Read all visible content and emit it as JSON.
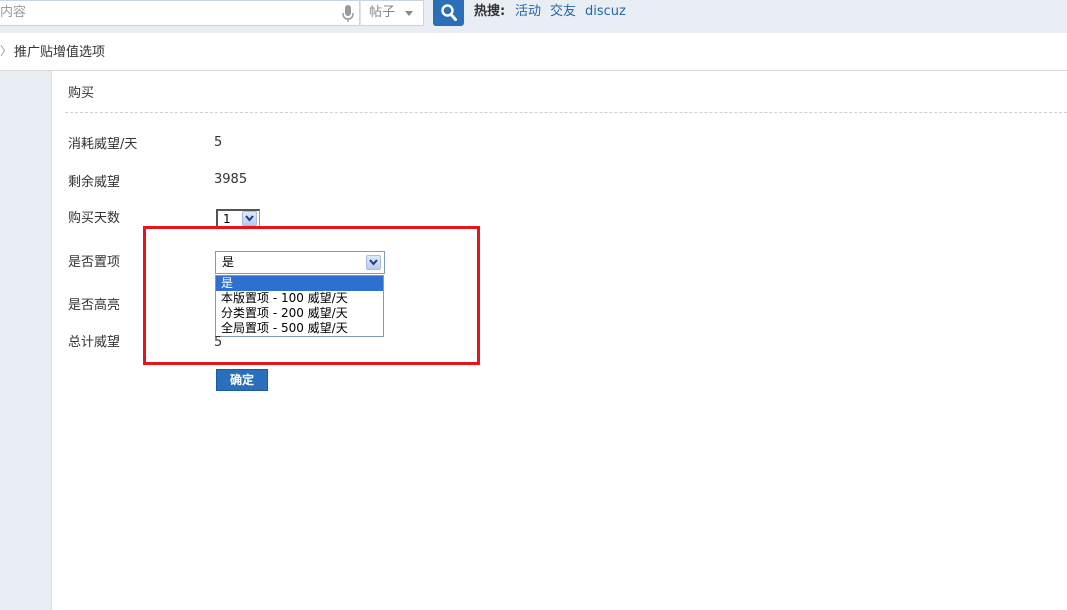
{
  "header": {
    "search_placeholder": "内容",
    "search_type": "帖子",
    "hot_label": "热搜:",
    "hot_links": [
      "活动",
      "交友",
      "discuz"
    ]
  },
  "breadcrumb": {
    "separator": "〉",
    "title": "推广贴增值选项"
  },
  "form": {
    "section_title": "购买",
    "rows": [
      {
        "label": "消耗威望/天",
        "value": "5"
      },
      {
        "label": "剩余威望",
        "value": "3985"
      },
      {
        "label": "购买天数",
        "value": "1"
      },
      {
        "label": "是否置项",
        "value": "是"
      },
      {
        "label": "是否高亮",
        "value": ""
      },
      {
        "label": "总计威望",
        "value": "5"
      }
    ],
    "top_options": [
      "是",
      "本版置项 - 100 威望/天",
      "分类置项 - 200 威望/天",
      "全局置项 - 500 威望/天"
    ],
    "confirm_label": "确定"
  },
  "colors": {
    "accent": "#2b6fb6",
    "highlight_box": "#e8141c",
    "selected_option": "#2f6fd0"
  }
}
